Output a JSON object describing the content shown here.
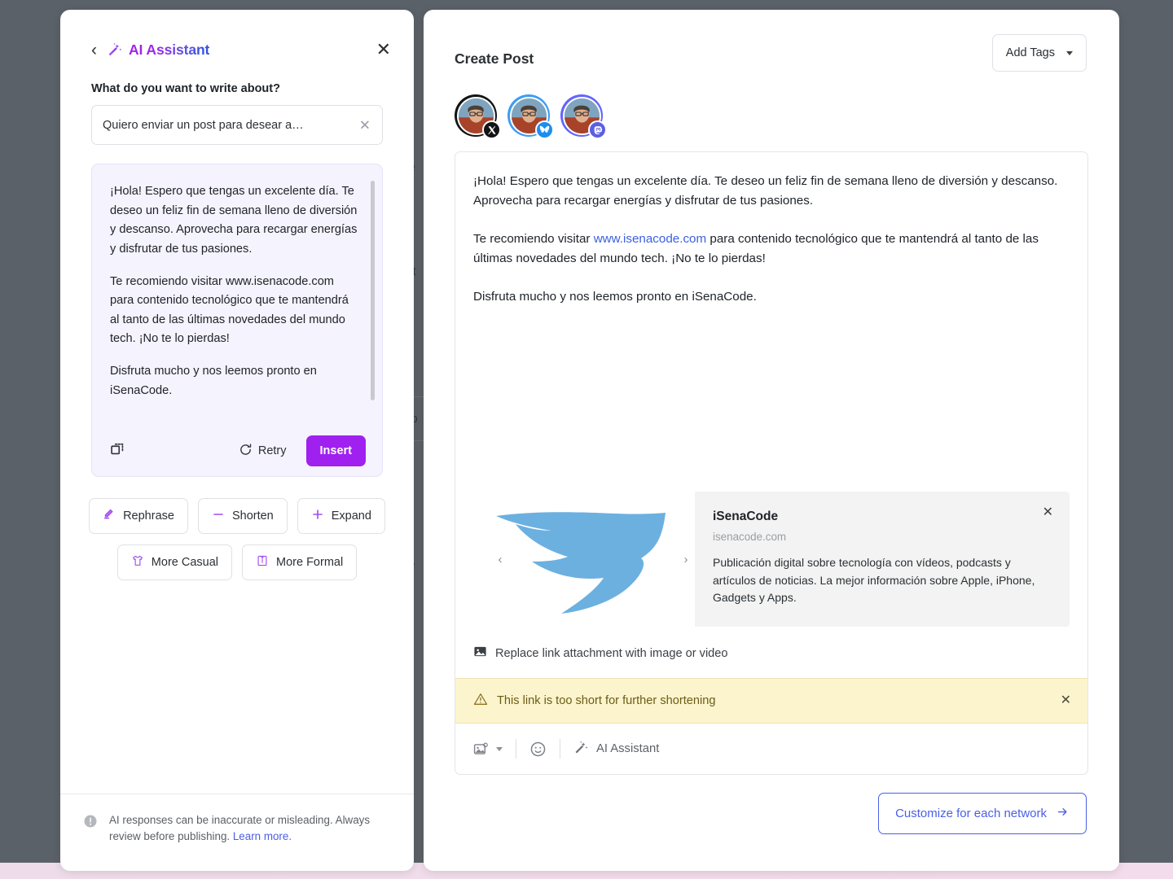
{
  "assistant": {
    "title": "AI Assistant",
    "back_icon": "chevron-left-icon",
    "wand_icon": "magic-wand-icon",
    "close_icon": "close-icon",
    "prompt_label": "What do you want to write about?",
    "prompt_value": "Quiero enviar un post para desear a…",
    "clear_icon": "clear-icon",
    "result_paragraphs": [
      "¡Hola! Espero que tengas un excelente día. Te deseo un feliz fin de semana lleno de diversión y descanso. Aprovecha para recargar energías y disfrutar de tus pasiones.",
      "Te recomiendo visitar www.isenacode.com para contenido tecnológico que te mantendrá al tanto de las últimas novedades del mundo tech. ¡No te lo pierdas!",
      "Disfruta mucho y nos leemos pronto en iSenaCode."
    ],
    "copy_icon": "copy-icon",
    "retry_label": "Retry",
    "retry_icon": "refresh-icon",
    "insert_label": "Insert",
    "accent_color": "#a020f0",
    "tone_buttons_row1": [
      {
        "label": "Rephrase",
        "icon": "pencil-icon"
      },
      {
        "label": "Shorten",
        "icon": "minus-icon"
      },
      {
        "label": "Expand",
        "icon": "plus-icon"
      }
    ],
    "tone_buttons_row2": [
      {
        "label": "More Casual",
        "icon": "tshirt-icon"
      },
      {
        "label": "More Formal",
        "icon": "dress-shirt-icon"
      }
    ],
    "footer_icon": "info-icon",
    "footer_text": "AI responses can be inaccurate or misleading. Always review before publishing. ",
    "footer_link": "Learn more."
  },
  "composer": {
    "title": "Create Post",
    "add_tags_label": "Add Tags",
    "add_tags_icon": "chevron-down-icon",
    "accounts": [
      {
        "network": "x",
        "badge_icon": "x-logo-icon",
        "ring_color": "#121416",
        "badge_color": "#121416"
      },
      {
        "network": "bluesky",
        "badge_icon": "bluesky-butterfly-icon",
        "ring_color": "#3c9df5",
        "badge_color": "#1b8ef0"
      },
      {
        "network": "mastodon",
        "badge_icon": "mastodon-icon",
        "ring_color": "#6364ff",
        "badge_color": "#5b5fe0"
      }
    ],
    "post_paragraphs": [
      {
        "before": "¡Hola! Espero que tengas un excelente día. Te deseo un feliz fin de semana lleno de diversión y descanso. Aprovecha para recargar energías y disfrutar de tus pasiones.",
        "link": "",
        "after": ""
      },
      {
        "before": "Te recomiendo visitar ",
        "link": "www.isenacode.com",
        "after": " para contenido tecnológico que te mantendrá al tanto de las últimas novedades del mundo tech. ¡No te lo pierdas!"
      },
      {
        "before": "Disfruta mucho y nos leemos pronto en iSenaCode.",
        "link": "",
        "after": ""
      }
    ],
    "link_preview": {
      "title": "iSenaCode",
      "domain": "isenacode.com",
      "description": "Publicación digital sobre tecnología con vídeos, podcasts y artículos de noticias. La mejor información sobre Apple, iPhone, Gadgets y Apps.",
      "image_icon": "twitter-bird-icon",
      "image_color": "#6cb0e0",
      "prev_icon": "chevron-left-icon",
      "next_icon": "chevron-right-icon",
      "close_icon": "close-icon"
    },
    "replace_label": "Replace link attachment with image or video",
    "replace_icon": "image-icon",
    "warning": {
      "icon": "warning-triangle-icon",
      "text": "This link is too short for further shortening",
      "close_icon": "close-icon",
      "background": "#fcf4cd"
    },
    "toolbar": {
      "media_icon": "image-plus-icon",
      "media_caret_icon": "chevron-down-icon",
      "emoji_icon": "emoji-smiley-icon",
      "ai_icon": "magic-wand-icon",
      "ai_label": "AI Assistant"
    },
    "customize_label": "Customize for each network",
    "customize_icon": "arrow-right-icon",
    "customize_color": "#4a5fe6"
  },
  "background": {
    "hidden_fragments": [
      "le",
      "nt",
      "c",
      "po",
      "fe"
    ]
  }
}
